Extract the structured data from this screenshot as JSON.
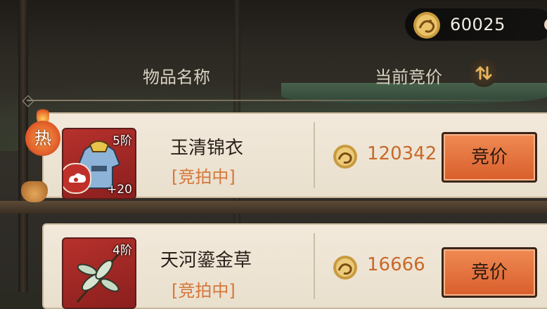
{
  "currency": {
    "icon": "dragon-coin-icon",
    "amount": "60025"
  },
  "header": {
    "col_name": "物品名称",
    "col_bid": "当前竞价",
    "sort_icon": "sort-arrows-icon"
  },
  "hot_badge": "热",
  "items": [
    {
      "tier": "5阶",
      "plus": "+20",
      "name": "玉清锦衣",
      "status": "[竞拍中]",
      "bid": "120342",
      "button": "竞价"
    },
    {
      "tier": "4阶",
      "name": "天河鎏金草",
      "status": "[竞拍中]",
      "bid": "16666",
      "button": "竞价"
    }
  ],
  "colors": {
    "bid_text": "#c8692a",
    "status_text": "#d5773a",
    "button": "#e9733f"
  }
}
